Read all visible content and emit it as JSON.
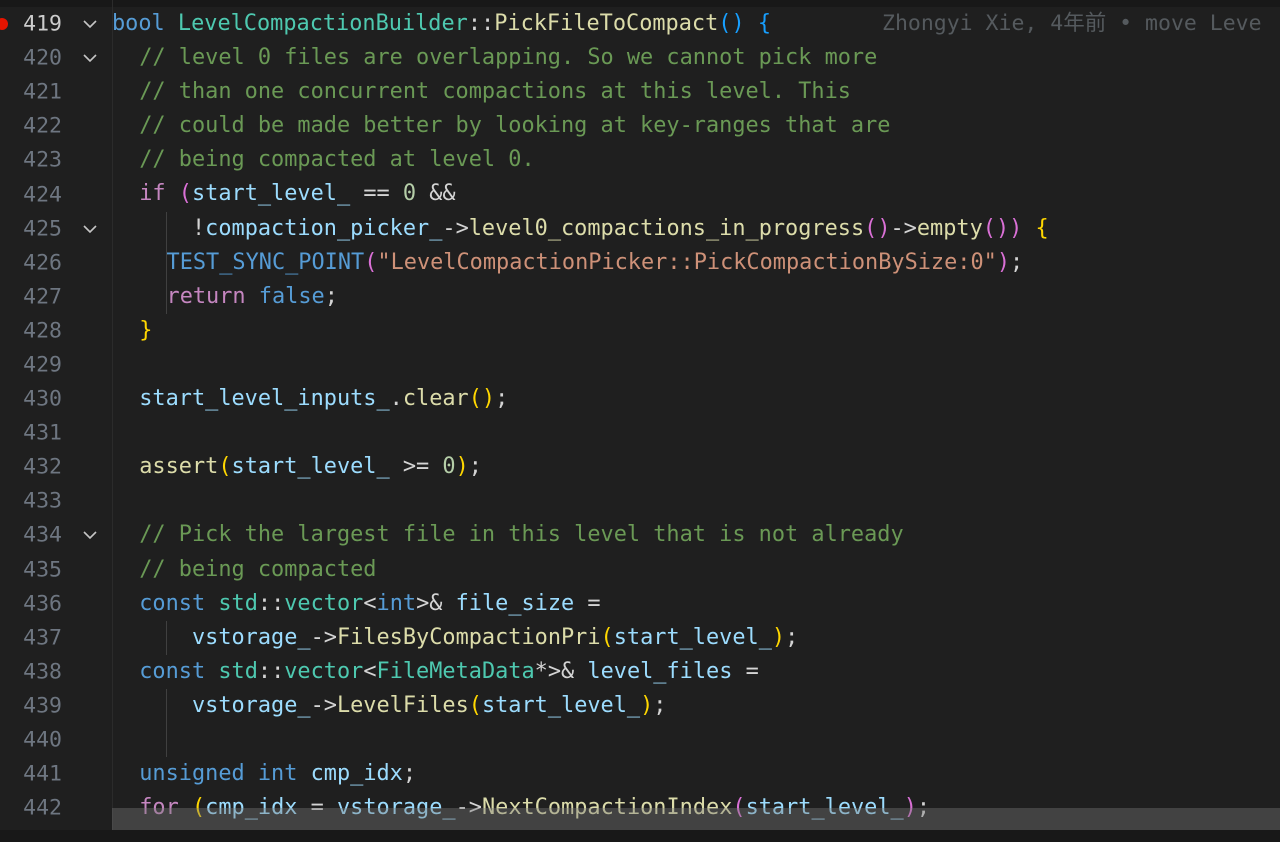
{
  "editor": {
    "blame": "Zhongyi Xie, 4年前 • move Leve",
    "lines": [
      {
        "num": "419",
        "current": true,
        "breakpoint": true,
        "fold": true,
        "indent": 0,
        "tokens": [
          [
            "kw",
            "bool"
          ],
          [
            "plain",
            " "
          ],
          [
            "type",
            "LevelCompactionBuilder"
          ],
          [
            "op",
            "::"
          ],
          [
            "fn",
            "PickFileToCompact"
          ],
          [
            "b3",
            "()"
          ],
          [
            "plain",
            " "
          ],
          [
            "b3",
            "{"
          ]
        ]
      },
      {
        "num": "420",
        "fold": true,
        "indent": 1,
        "tokens": [
          [
            "com",
            "// level 0 files are overlapping. So we cannot pick more"
          ]
        ]
      },
      {
        "num": "421",
        "indent": 1,
        "tokens": [
          [
            "com",
            "// than one concurrent compactions at this level. This"
          ]
        ]
      },
      {
        "num": "422",
        "indent": 1,
        "tokens": [
          [
            "com",
            "// could be made better by looking at key-ranges that are"
          ]
        ]
      },
      {
        "num": "423",
        "indent": 1,
        "tokens": [
          [
            "com",
            "// being compacted at level 0."
          ]
        ]
      },
      {
        "num": "424",
        "indent": 1,
        "tokens": [
          [
            "ctrl",
            "if"
          ],
          [
            "plain",
            " "
          ],
          [
            "b2",
            "("
          ],
          [
            "var",
            "start_level_"
          ],
          [
            "op",
            " == "
          ],
          [
            "num",
            "0"
          ],
          [
            "op",
            " &&"
          ]
        ]
      },
      {
        "num": "425",
        "fold": true,
        "indent": 1,
        "extraGuides": [
          2
        ],
        "tokens": [
          [
            "plain",
            "    "
          ],
          [
            "op",
            "!"
          ],
          [
            "var",
            "compaction_picker_"
          ],
          [
            "op",
            "->"
          ],
          [
            "fn",
            "level0_compactions_in_progress"
          ],
          [
            "b2",
            "()"
          ],
          [
            "op",
            "->"
          ],
          [
            "fn",
            "empty"
          ],
          [
            "b2",
            "()"
          ],
          [
            "b2",
            ")"
          ],
          [
            "plain",
            " "
          ],
          [
            "b1",
            "{"
          ]
        ]
      },
      {
        "num": "426",
        "indent": 2,
        "tokens": [
          [
            "macro",
            "TEST_SYNC_POINT"
          ],
          [
            "b2",
            "("
          ],
          [
            "str",
            "\"LevelCompactionPicker::PickCompactionBySize:0\""
          ],
          [
            "b2",
            ")"
          ],
          [
            "op",
            ";"
          ]
        ]
      },
      {
        "num": "427",
        "indent": 2,
        "tokens": [
          [
            "ctrl",
            "return"
          ],
          [
            "plain",
            " "
          ],
          [
            "kw",
            "false"
          ],
          [
            "op",
            ";"
          ]
        ]
      },
      {
        "num": "428",
        "indent": 1,
        "tokens": [
          [
            "b1",
            "}"
          ]
        ]
      },
      {
        "num": "429",
        "indent": 1,
        "tokens": []
      },
      {
        "num": "430",
        "indent": 1,
        "tokens": [
          [
            "var",
            "start_level_inputs_"
          ],
          [
            "op",
            "."
          ],
          [
            "fn",
            "clear"
          ],
          [
            "b1",
            "()"
          ],
          [
            "op",
            ";"
          ]
        ]
      },
      {
        "num": "431",
        "indent": 1,
        "tokens": []
      },
      {
        "num": "432",
        "indent": 1,
        "tokens": [
          [
            "fn",
            "assert"
          ],
          [
            "b1",
            "("
          ],
          [
            "var",
            "start_level_"
          ],
          [
            "op",
            " >= "
          ],
          [
            "num",
            "0"
          ],
          [
            "b1",
            ")"
          ],
          [
            "op",
            ";"
          ]
        ]
      },
      {
        "num": "433",
        "indent": 1,
        "tokens": []
      },
      {
        "num": "434",
        "fold": true,
        "indent": 1,
        "tokens": [
          [
            "com",
            "// Pick the largest file in this level that is not already"
          ]
        ]
      },
      {
        "num": "435",
        "indent": 1,
        "tokens": [
          [
            "com",
            "// being compacted"
          ]
        ]
      },
      {
        "num": "436",
        "indent": 1,
        "tokens": [
          [
            "kw",
            "const"
          ],
          [
            "plain",
            " "
          ],
          [
            "type",
            "std"
          ],
          [
            "op",
            "::"
          ],
          [
            "type",
            "vector"
          ],
          [
            "op",
            "<"
          ],
          [
            "kw",
            "int"
          ],
          [
            "op",
            ">&"
          ],
          [
            "plain",
            " "
          ],
          [
            "var",
            "file_size"
          ],
          [
            "op",
            " ="
          ]
        ]
      },
      {
        "num": "437",
        "indent": 1,
        "extraGuides": [
          2
        ],
        "tokens": [
          [
            "plain",
            "    "
          ],
          [
            "var",
            "vstorage_"
          ],
          [
            "op",
            "->"
          ],
          [
            "fn",
            "FilesByCompactionPri"
          ],
          [
            "b1",
            "("
          ],
          [
            "var",
            "start_level_"
          ],
          [
            "b1",
            ")"
          ],
          [
            "op",
            ";"
          ]
        ]
      },
      {
        "num": "438",
        "indent": 1,
        "tokens": [
          [
            "kw",
            "const"
          ],
          [
            "plain",
            " "
          ],
          [
            "type",
            "std"
          ],
          [
            "op",
            "::"
          ],
          [
            "type",
            "vector"
          ],
          [
            "op",
            "<"
          ],
          [
            "type",
            "FileMetaData"
          ],
          [
            "op",
            "*>&"
          ],
          [
            "plain",
            " "
          ],
          [
            "var",
            "level_files"
          ],
          [
            "op",
            " ="
          ]
        ]
      },
      {
        "num": "439",
        "indent": 1,
        "extraGuides": [
          2
        ],
        "tokens": [
          [
            "plain",
            "    "
          ],
          [
            "var",
            "vstorage_"
          ],
          [
            "op",
            "->"
          ],
          [
            "fn",
            "LevelFiles"
          ],
          [
            "b1",
            "("
          ],
          [
            "var",
            "start_level_"
          ],
          [
            "b1",
            ")"
          ],
          [
            "op",
            ";"
          ]
        ]
      },
      {
        "num": "440",
        "indent": 1,
        "extraGuides": [
          2
        ],
        "tokens": []
      },
      {
        "num": "441",
        "indent": 1,
        "tokens": [
          [
            "kw",
            "unsigned"
          ],
          [
            "plain",
            " "
          ],
          [
            "kw",
            "int"
          ],
          [
            "plain",
            " "
          ],
          [
            "var",
            "cmp_idx"
          ],
          [
            "op",
            ";"
          ]
        ]
      },
      {
        "num": "442",
        "indent": 1,
        "tokens": [
          [
            "ctrl",
            "for"
          ],
          [
            "plain",
            " "
          ],
          [
            "b1",
            "("
          ],
          [
            "var",
            "cmp_idx"
          ],
          [
            "op",
            " = "
          ],
          [
            "var",
            "vstorage_"
          ],
          [
            "op",
            "->"
          ],
          [
            "fn",
            "NextCompactionIndex"
          ],
          [
            "b2",
            "("
          ],
          [
            "var",
            "start_level_"
          ],
          [
            "b2",
            ")"
          ],
          [
            "op",
            ";"
          ]
        ]
      }
    ]
  }
}
